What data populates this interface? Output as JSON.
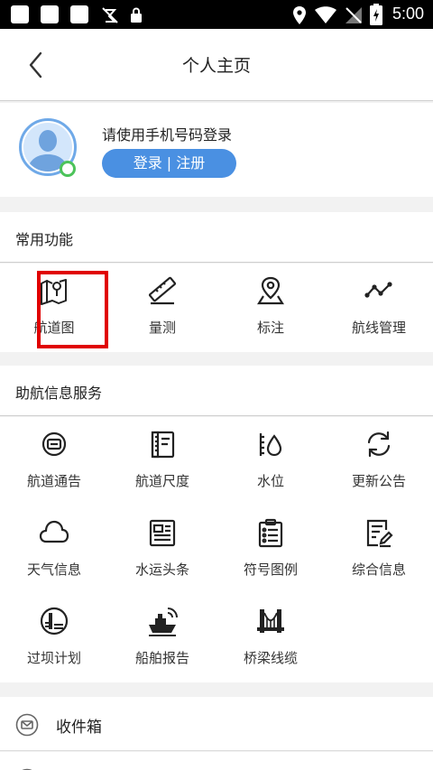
{
  "status_bar": {
    "time": "5:00"
  },
  "header": {
    "title": "个人主页"
  },
  "profile": {
    "login_hint": "请使用手机号码登录",
    "login_button": "登录 | 注册"
  },
  "sections": {
    "common": {
      "title": "常用功能",
      "items": [
        {
          "label": "航道图",
          "icon": "channel-map-icon"
        },
        {
          "label": "量测",
          "icon": "ruler-icon"
        },
        {
          "label": "标注",
          "icon": "map-pin-icon"
        },
        {
          "label": "航线管理",
          "icon": "route-icon"
        }
      ]
    },
    "nav_info": {
      "title": "助航信息服务",
      "items": [
        {
          "label": "航道通告",
          "icon": "notice-badge-icon"
        },
        {
          "label": "航道尺度",
          "icon": "scale-doc-icon"
        },
        {
          "label": "水位",
          "icon": "water-level-icon"
        },
        {
          "label": "更新公告",
          "icon": "refresh-icon"
        },
        {
          "label": "天气信息",
          "icon": "cloud-icon"
        },
        {
          "label": "水运头条",
          "icon": "newspaper-icon"
        },
        {
          "label": "符号图例",
          "icon": "clipboard-list-icon"
        },
        {
          "label": "综合信息",
          "icon": "doc-edit-icon"
        },
        {
          "label": "过坝计划",
          "icon": "dam-icon"
        },
        {
          "label": "船舶报告",
          "icon": "ship-signal-icon"
        },
        {
          "label": "桥梁线缆",
          "icon": "bridge-icon"
        }
      ]
    }
  },
  "inbox": {
    "label": "收件箱"
  },
  "colors": {
    "accent": "#4a90e2",
    "online": "#4cc35a",
    "highlight": "#e00000"
  }
}
